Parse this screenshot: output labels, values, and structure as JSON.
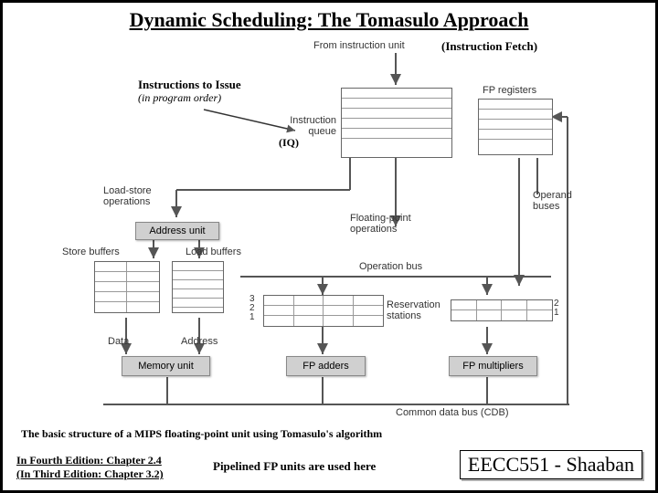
{
  "title": "Dynamic Scheduling: The Tomasulo Approach",
  "annotations": {
    "instruction_fetch": "(Instruction Fetch)",
    "instructions_to_issue": "Instructions to Issue",
    "in_program_order": "(in program order)",
    "iq": "(IQ)"
  },
  "diagram": {
    "from_instruction_unit": "From instruction unit",
    "instruction_queue": "Instruction queue",
    "fp_registers": "FP registers",
    "load_store_operations": "Load-store operations",
    "address_unit": "Address unit",
    "floating_point_operations": "Floating-point operations",
    "operand_buses": "Operand buses",
    "store_buffers": "Store buffers",
    "load_buffers": "Load buffers",
    "operation_bus": "Operation bus",
    "reservation_stations": "Reservation stations",
    "rs_left_labels": [
      "3",
      "2",
      "1"
    ],
    "rs_right_labels": [
      "2",
      "1"
    ],
    "data": "Data",
    "address": "Address",
    "memory_unit": "Memory unit",
    "fp_adders": "FP adders",
    "fp_multipliers": "FP multipliers",
    "common_data_bus": "Common data bus (CDB)"
  },
  "caption": "The basic structure of a MIPS floating-point unit using Tomasulo's algorithm",
  "footer": {
    "edition4": "In Fourth Edition: Chapter 2.4",
    "edition3": "(In Third Edition: Chapter 3.2)",
    "pipelined": "Pipelined FP units are used here",
    "course": "EECC551 - Shaaban"
  }
}
